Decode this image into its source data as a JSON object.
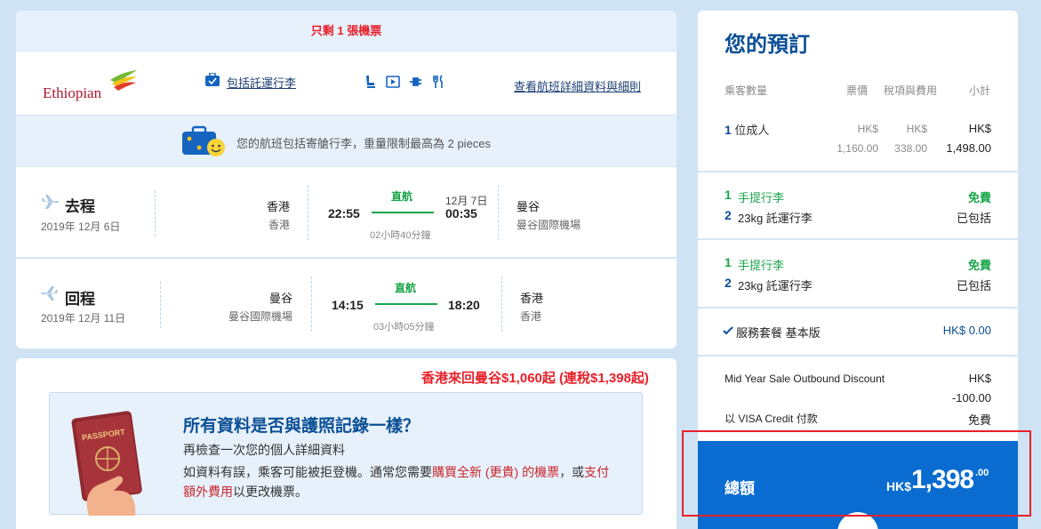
{
  "flight": {
    "seats_left": "只剩 1 張機票",
    "airline": "Ethiopian",
    "baggage_included": "包括託運行李",
    "details_link": "查看航班詳細資料與細則",
    "baggage_note": "您的航班包括寄艙行李，重量限制最高為 2 pieces",
    "outbound": {
      "title": "去程",
      "date": "2019年 12月 6日",
      "from_city": "香港",
      "from_airport": "香港",
      "depart_time": "22:55",
      "direct": "直航",
      "arrive_date": "12月 7日",
      "arrive_time": "00:35",
      "duration": "02小時40分鐘",
      "to_city": "曼谷",
      "to_airport": "曼谷國際機場"
    },
    "inbound": {
      "title": "回程",
      "date": "2019年 12月 11日",
      "from_city": "曼谷",
      "from_airport": "曼谷國際機場",
      "depart_time": "14:15",
      "direct": "直航",
      "arrive_time": "18:20",
      "duration": "03小時05分鐘",
      "to_city": "香港",
      "to_airport": "香港"
    }
  },
  "promo_text": "香港來回曼谷$1,060起 (連稅$1,398起)",
  "passport": {
    "heading": "所有資料是否與護照記錄一樣？",
    "subheading": "再檢查一次您的個人詳細資料",
    "text_1": "如資料有誤，乘客可能被拒登機。通常您需要",
    "link_1": "購買全新 (更貴) 的機票",
    "text_2": "，或",
    "link_2": "支付額外費用",
    "text_3": "以更改機票。",
    "image_label": "PASSPORT"
  },
  "summary": {
    "title": "您的預訂",
    "headers": {
      "passengers": "乘客數量",
      "fare": "票價",
      "tax": "稅項與費用",
      "subtotal": "小計"
    },
    "passenger_row": {
      "count": "1",
      "label": "位成人",
      "fare_currency": "HK$",
      "fare": "1,160.00",
      "tax_currency": "HK$",
      "tax": "338.00",
      "sub_currency": "HK$",
      "subtotal": "1,498.00"
    },
    "baggage_outbound": [
      {
        "count": "1",
        "label": "手提行李",
        "value": "免費"
      },
      {
        "count": "2",
        "label": "23kg 託運行李",
        "value": "已包括"
      }
    ],
    "baggage_inbound": [
      {
        "count": "1",
        "label": "手提行李",
        "value": "免費"
      },
      {
        "count": "2",
        "label": "23kg 託運行李",
        "value": "已包括"
      }
    ],
    "service_package": "服務套餐 基本版",
    "service_price": "HK$ 0.00",
    "discount_label": "Mid Year Sale Outbound Discount",
    "discount_currency": "HK$",
    "discount_value": "-100.00",
    "payment_label": "以 VISA Credit 付款",
    "payment_value": "免費",
    "total_label": "總額",
    "total_currency": "HK$",
    "total_main": "1,398",
    "total_cents": ".00"
  },
  "colors": {
    "brand_blue": "#0b4f95",
    "total_bg": "#0a6cd0",
    "green": "#1aa64a",
    "red": "#e8202a",
    "page_bg": "#cfe3f5"
  }
}
